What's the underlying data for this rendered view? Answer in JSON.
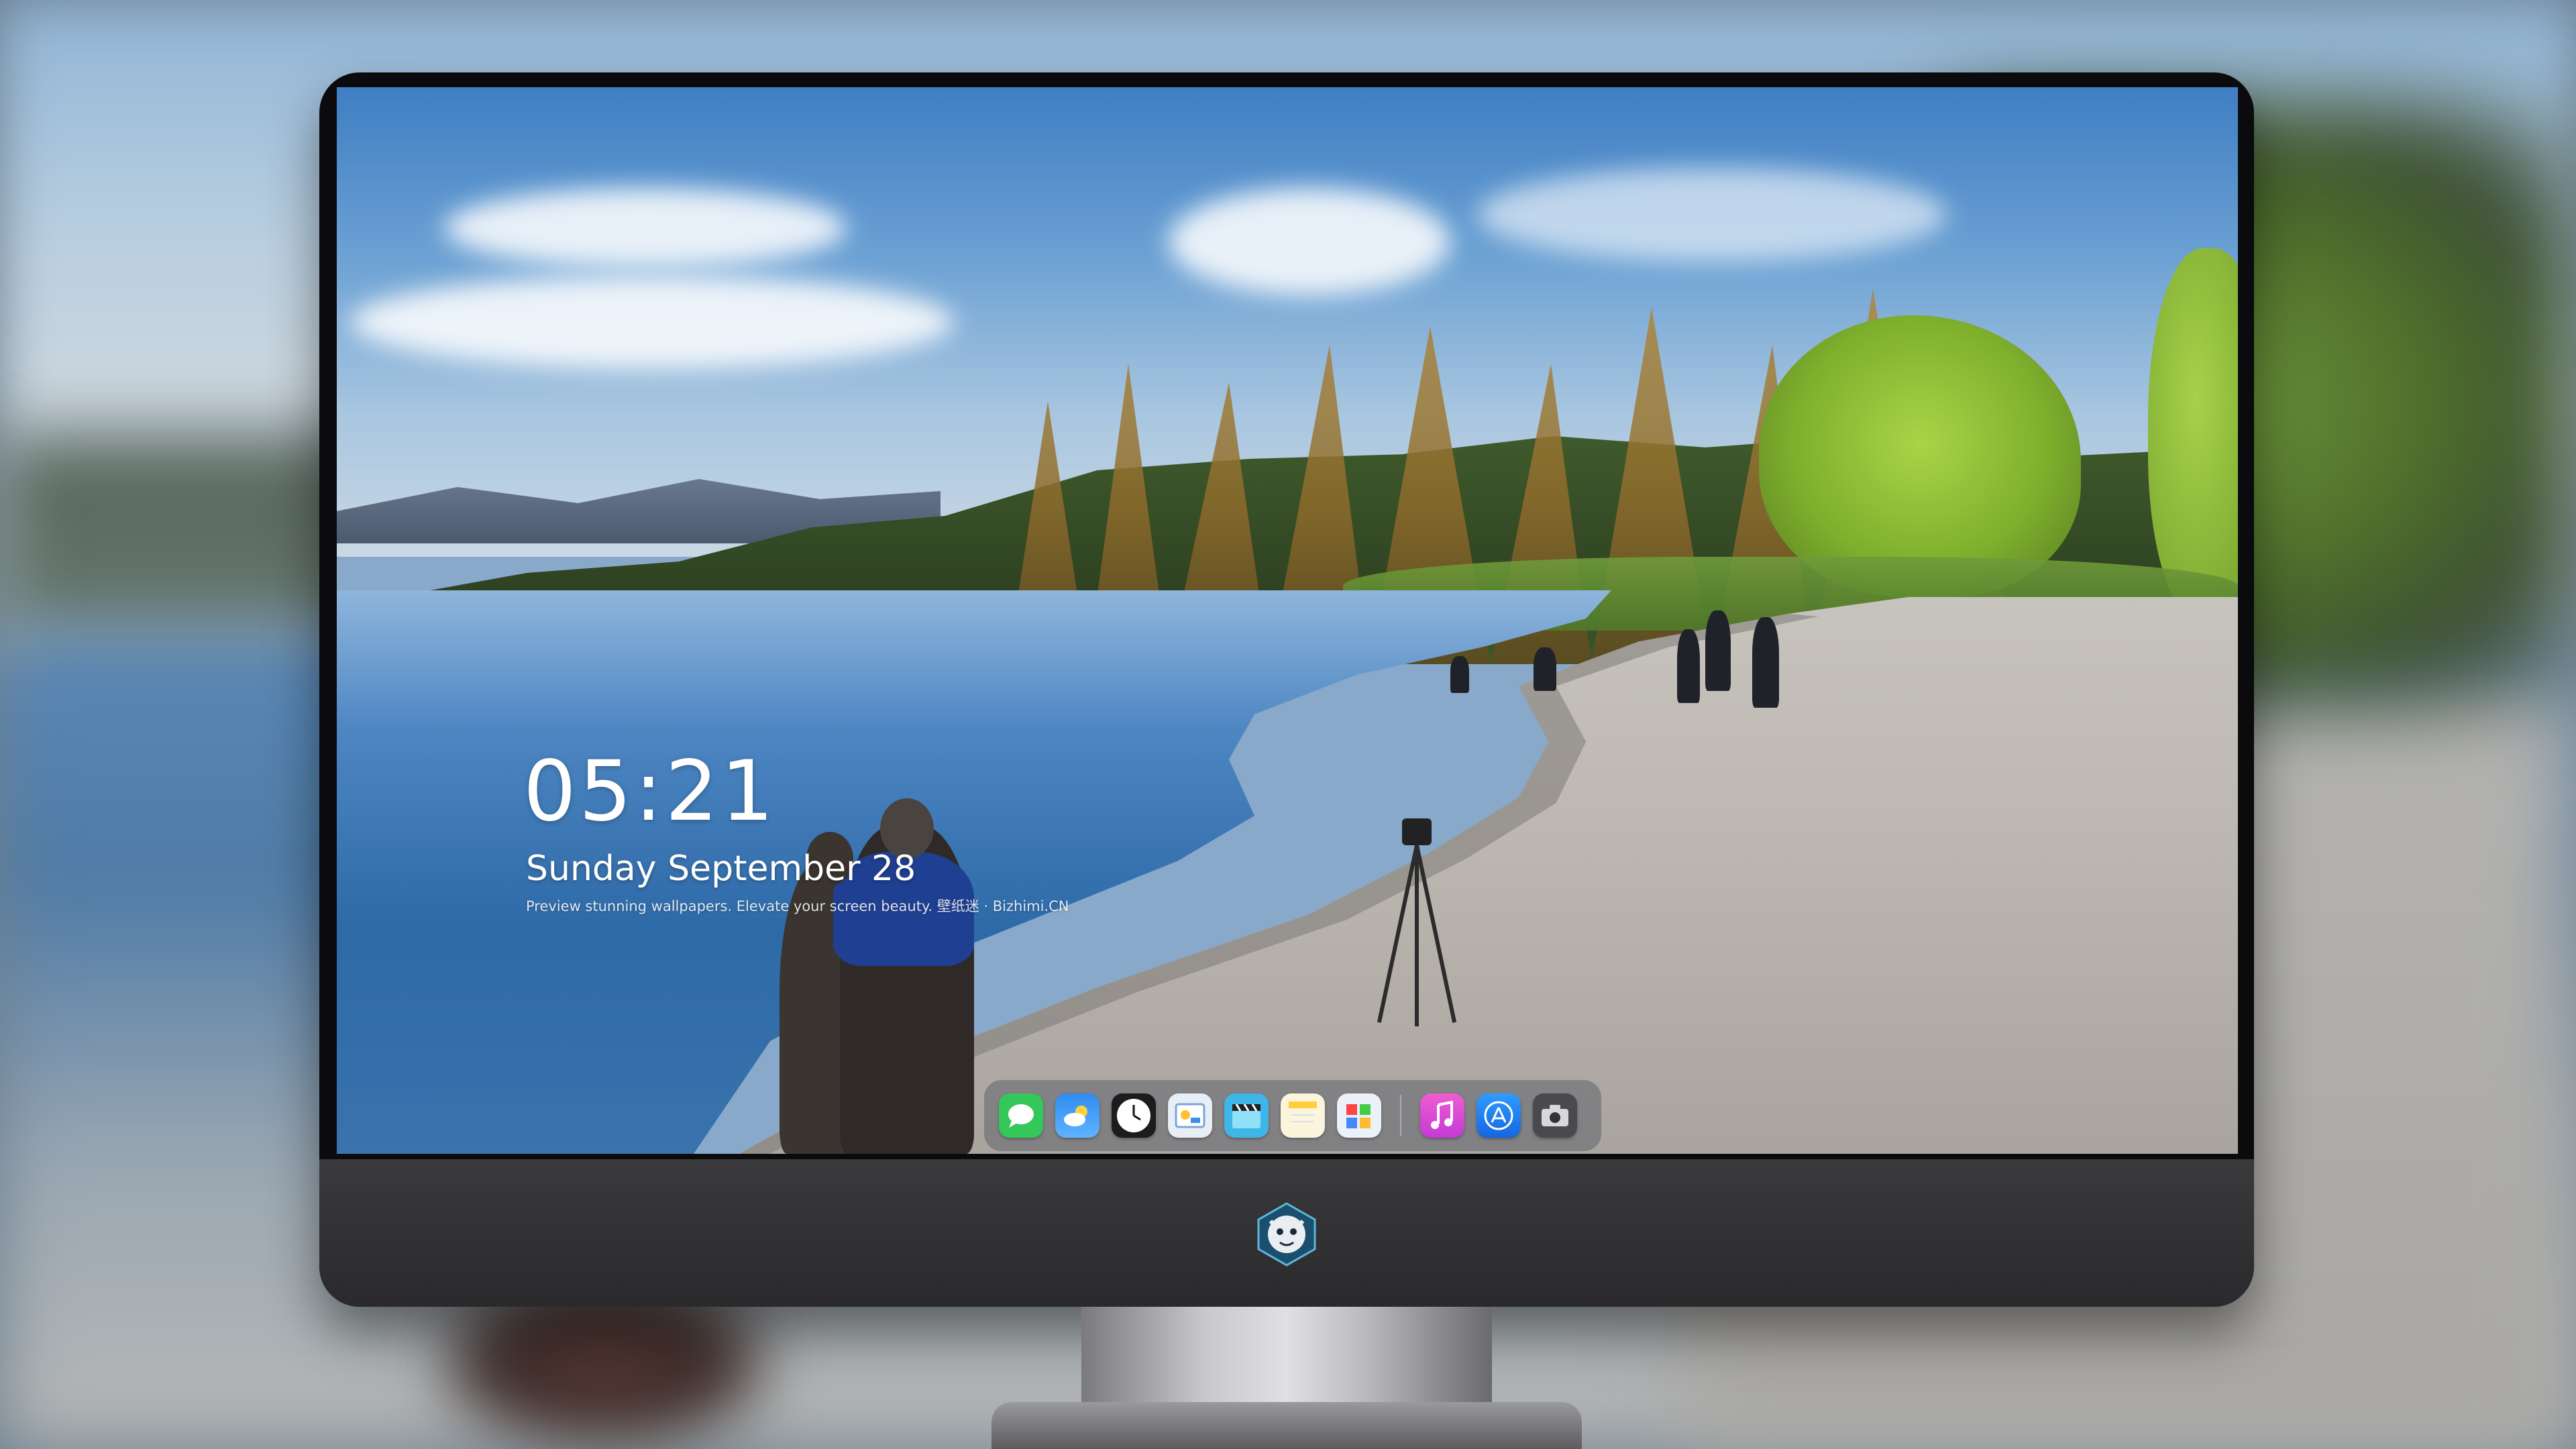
{
  "lockscreen": {
    "time": "05:21",
    "date": "Sunday September  28",
    "tagline": "Preview stunning wallpapers. Elevate your screen beauty. 壁纸迷 · Bizhimi.CN"
  },
  "dock": {
    "apps": [
      {
        "name": "messages-icon",
        "glyph": "💬",
        "color": "#34c759"
      },
      {
        "name": "weather-icon",
        "glyph": "⛅",
        "color": "#2f8cf0"
      },
      {
        "name": "clock-icon",
        "glyph": "🕑",
        "color": "#1c1c1e"
      },
      {
        "name": "preview-icon",
        "glyph": "🖼",
        "color": "#e8eef5"
      },
      {
        "name": "clips-icon",
        "glyph": "🎬",
        "color": "#3fb6e8"
      },
      {
        "name": "notes-icon",
        "glyph": "📝",
        "color": "#f7f2dc"
      },
      {
        "name": "photos-icon",
        "glyph": "🖼",
        "color": "#eaf1f8"
      },
      {
        "name": "music-icon",
        "glyph": "♫",
        "color": "#e040c8"
      },
      {
        "name": "app-store-icon",
        "glyph": "A",
        "color": "#1f7cf2"
      },
      {
        "name": "camera-icon",
        "glyph": "📷",
        "color": "#4a4a4e"
      }
    ]
  },
  "colors": {
    "bezel": "#0b0b0d",
    "chin": "#2f2f31",
    "text": "#ffffff"
  }
}
